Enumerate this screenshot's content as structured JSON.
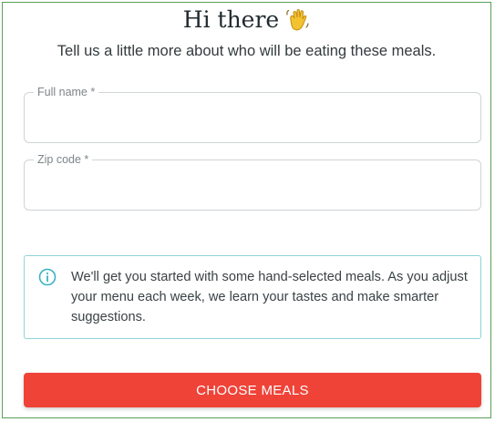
{
  "header": {
    "title": "Hi there",
    "title_icon": "waving-hand-icon",
    "subtitle": "Tell us a little more about who will be eating these meals."
  },
  "form": {
    "full_name": {
      "label": "Full name *",
      "value": ""
    },
    "zip_code": {
      "label": "Zip code *",
      "value": ""
    }
  },
  "info": {
    "icon": "info-circle-icon",
    "text": "We'll get you started with some hand-selected meals. As you adjust your menu each week, we learn your tastes and make smarter suggestions."
  },
  "actions": {
    "choose_meals_label": "CHOOSE MEALS"
  },
  "colors": {
    "frame_border": "#58a058",
    "info_border": "#8fd2da",
    "info_icon": "#3bb3c4",
    "cta_background": "#ef4338",
    "wave_emoji": "#f2c230"
  }
}
